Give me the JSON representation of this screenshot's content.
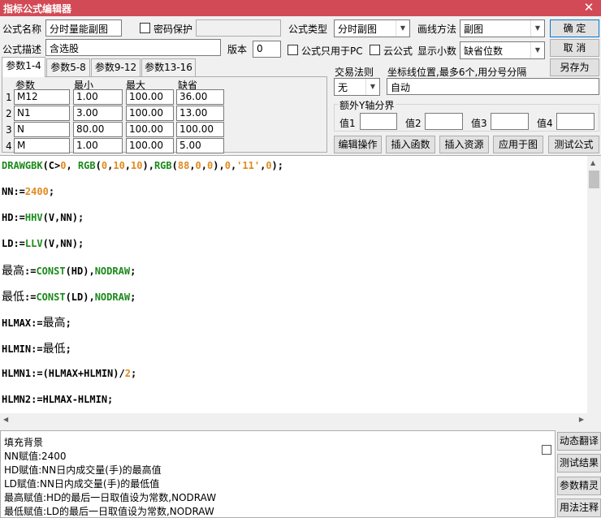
{
  "window": {
    "title": "指标公式编辑器",
    "close_glyph": "✕"
  },
  "form": {
    "name_label": "公式名称",
    "name_value": "分时量能副图",
    "password_label": "密码保护",
    "password_value": "",
    "type_label": "公式类型",
    "type_value": "分时副图",
    "draw_label": "画线方法",
    "draw_value": "副图",
    "desc_label": "公式描述",
    "desc_value": "含选股",
    "version_label": "版本",
    "version_value": "0",
    "pc_only_label": "公式只用于PC",
    "cloud_label": "云公式",
    "decimals_label": "显示小数",
    "decimals_value": "缺省位数"
  },
  "buttons": {
    "ok": "确  定",
    "cancel": "取  消",
    "save_as": "另存为"
  },
  "tabs": [
    "参数1-4",
    "参数5-8",
    "参数9-12",
    "参数13-16"
  ],
  "params": {
    "headers": [
      "参数",
      "最小",
      "最大",
      "缺省"
    ],
    "rows": [
      {
        "idx": "1",
        "name": "M12",
        "min": "1.00",
        "max": "100.00",
        "def": "36.00"
      },
      {
        "idx": "2",
        "name": "N1",
        "min": "3.00",
        "max": "100.00",
        "def": "13.00"
      },
      {
        "idx": "3",
        "name": "N",
        "min": "80.00",
        "max": "100.00",
        "def": "100.00"
      },
      {
        "idx": "4",
        "name": "M",
        "min": "1.00",
        "max": "100.00",
        "def": "5.00"
      }
    ]
  },
  "trade": {
    "label": "交易法则",
    "value": "无"
  },
  "axis": {
    "label": "坐标线位置,最多6个,用分号分隔",
    "value": "自动"
  },
  "yaxis": {
    "label": "额外Y轴分界",
    "v1": "值1",
    "v2": "值2",
    "v3": "值3",
    "v4": "值4"
  },
  "toolbar": [
    "编辑操作",
    "插入函数",
    "插入资源",
    "应用于图",
    "测试公式"
  ],
  "code_lines": [
    "DRAWGBK(C>0, RGB(0,10,10),RGB(88,0,0),0,'11',0);",
    "NN:=2400;",
    "HD:=HHV(V,NN);",
    "LD:=LLV(V,NN);",
    "最高:=CONST(HD),NODRAW;",
    "最低:=CONST(LD),NODRAW;",
    "HLMAX:=最高;",
    "HLMIN:=最低;",
    "HLMN1:=(HLMAX+HLMIN)/2;",
    "HLMN2:=HLMAX-HLMIN;"
  ],
  "help_lines": [
    "填充背景",
    "NN赋值:2400",
    "HD赋值:NN日内成交量(手)的最高值",
    "LD赋值:NN日内成交量(手)的最低值",
    "最高赋值:HD的最后一日取值设为常数,NODRAW",
    "最低赋值:LD的最后一日取值设为常数,NODRAW"
  ],
  "side_buttons": [
    "动态翻译",
    "测试结果",
    "参数精灵",
    "用法注释"
  ],
  "colors": {
    "title_bar": "#d24a55",
    "keyword": "#1a8a1a",
    "number": "#e08a1e"
  }
}
